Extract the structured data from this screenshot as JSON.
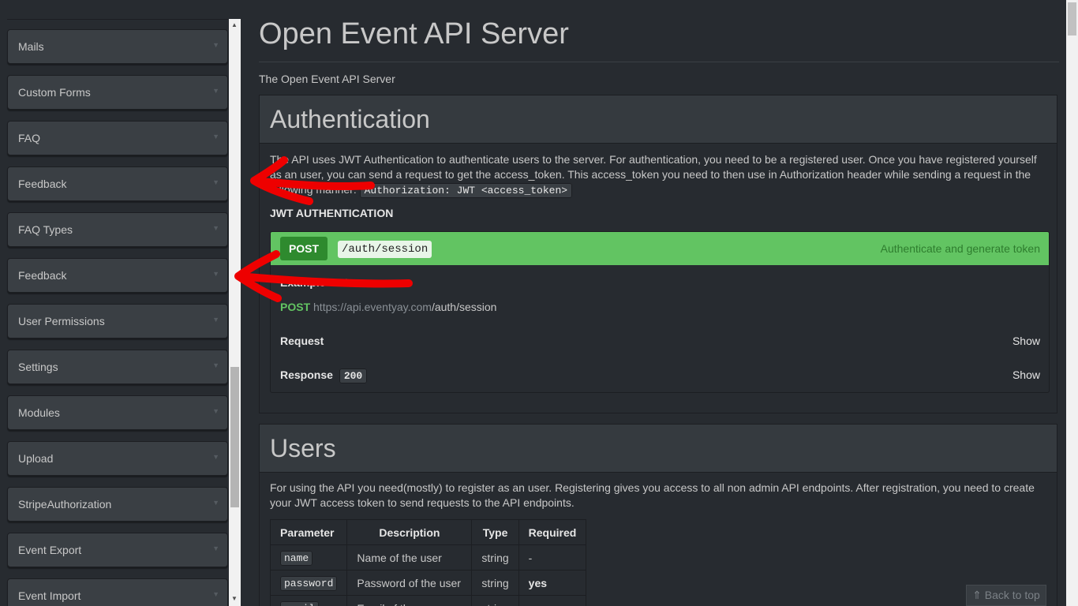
{
  "sidebar": {
    "items": [
      {
        "label": "Mails"
      },
      {
        "label": "Custom Forms"
      },
      {
        "label": "FAQ"
      },
      {
        "label": "Feedback"
      },
      {
        "label": "FAQ Types"
      },
      {
        "label": "Feedback"
      },
      {
        "label": "User Permissions"
      },
      {
        "label": "Settings"
      },
      {
        "label": "Modules"
      },
      {
        "label": "Upload"
      },
      {
        "label": "StripeAuthorization"
      },
      {
        "label": "Event Export"
      },
      {
        "label": "Event Import"
      }
    ],
    "chevron_icon": "chevron-down-icon"
  },
  "page": {
    "title": "Open Event API Server",
    "subtitle": "The Open Event API Server"
  },
  "auth": {
    "heading": "Authentication",
    "intro": "The API uses JWT Authentication to authenticate users to the server. For authentication, you need to be a registered user. Once you have registered yourself as an user, you can send a request to get the access_token. This access_token you need to then use in Authorization header while sending a request in the following manner:",
    "header_code": "Authorization: JWT <access_token>",
    "jwt_heading": "JWT AUTHENTICATION",
    "endpoint": {
      "method": "POST",
      "path": "/auth/session",
      "summary": "Authenticate and generate token",
      "example_label": "Example URI",
      "example_method": "POST",
      "example_host": "https://api.eventyay.com",
      "example_path": "/auth/session",
      "request_label": "Request",
      "response_label": "Response",
      "response_code": "200",
      "show_label": "Show"
    }
  },
  "users": {
    "heading": "Users",
    "intro": "For using the API you need(mostly) to register as an user. Registering gives you access to all non admin API endpoints. After registration, you need to create your JWT access token to send requests to the API endpoints.",
    "table": {
      "headers": [
        "Parameter",
        "Description",
        "Type",
        "Required"
      ],
      "rows": [
        {
          "param": "name",
          "desc": "Name of the user",
          "type": "string",
          "req": "-"
        },
        {
          "param": "password",
          "desc": "Password of the user",
          "type": "string",
          "req": "yes"
        },
        {
          "param": "email",
          "desc": "Email of the user",
          "type": "string",
          "req": "yes"
        }
      ]
    }
  },
  "back_to_top": "Back to top",
  "colors": {
    "background": "#272b30",
    "post_green": "#62c462",
    "method_dark_green": "#2e8a2e",
    "annotation_red": "#ee0000"
  }
}
